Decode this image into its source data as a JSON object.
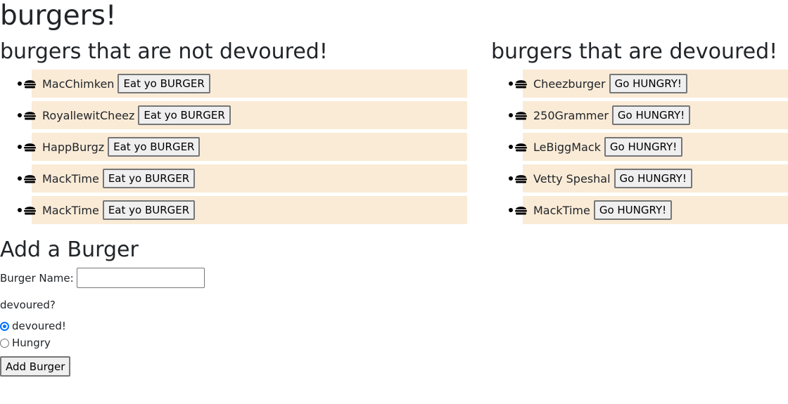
{
  "page_title": "burgers!",
  "not_devoured": {
    "heading": "burgers that are not devoured!",
    "button_label": "Eat yo BURGER",
    "items": [
      {
        "name": "MacChimken"
      },
      {
        "name": "RoyallewitCheez"
      },
      {
        "name": "HappBurgz"
      },
      {
        "name": "MackTime"
      },
      {
        "name": "MackTime"
      }
    ]
  },
  "devoured": {
    "heading": "burgers that are devoured!",
    "button_label": "Go HUNGRY!",
    "items": [
      {
        "name": "Cheezburger"
      },
      {
        "name": "250Grammer"
      },
      {
        "name": "LeBiggMack"
      },
      {
        "name": "Vetty Speshal"
      },
      {
        "name": "MackTime"
      }
    ]
  },
  "add_form": {
    "heading": "Add a Burger",
    "name_label": "Burger Name:",
    "name_value": "",
    "question": "devoured?",
    "options": [
      {
        "label": "devoured!",
        "checked": true
      },
      {
        "label": "Hungry",
        "checked": false
      }
    ],
    "submit_label": "Add Burger"
  },
  "icons": {
    "burger_icon": "hamburger-icon"
  },
  "colors": {
    "item_background": "#faebd7",
    "radio_accent": "#0075ff"
  }
}
